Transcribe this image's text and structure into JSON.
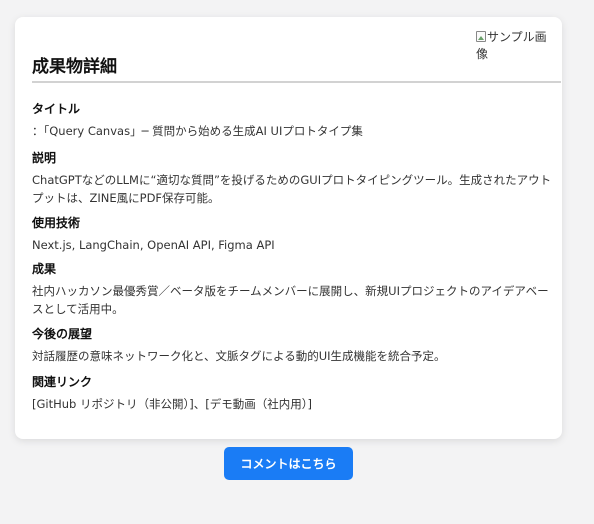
{
  "card": {
    "title": "成果物詳細",
    "image_alt": "サンプル画像"
  },
  "sections": [
    {
      "label": "タイトル",
      "body": "：「Query Canvas」─ 質問から始める生成AI UIプロトタイプ集"
    },
    {
      "label": "説明",
      "body": "ChatGPTなどのLLMに“適切な質問”を投げるためのGUIプロトタイピングツール。生成されたアウトプットは、ZINE風にPDF保存可能。"
    },
    {
      "label": "使用技術",
      "body": "Next.js, LangChain, OpenAI API, Figma API"
    },
    {
      "label": "成果",
      "body": "社内ハッカソン最優秀賞／ベータ版をチームメンバーに展開し、新規UIプロジェクトのアイデアベースとして活用中。"
    },
    {
      "label": "今後の展望",
      "body": "対話履歴の意味ネットワーク化と、文脈タグによる動的UI生成機能を統合予定。"
    },
    {
      "label": "関連リンク",
      "body": "[GitHub リポジトリ（非公開）]、[デモ動画（社内用）]"
    }
  ],
  "comment_button_label": "コメントはこちら",
  "colors": {
    "accent": "#1a7cf5",
    "background": "#f3f3f4",
    "card": "#ffffff"
  }
}
